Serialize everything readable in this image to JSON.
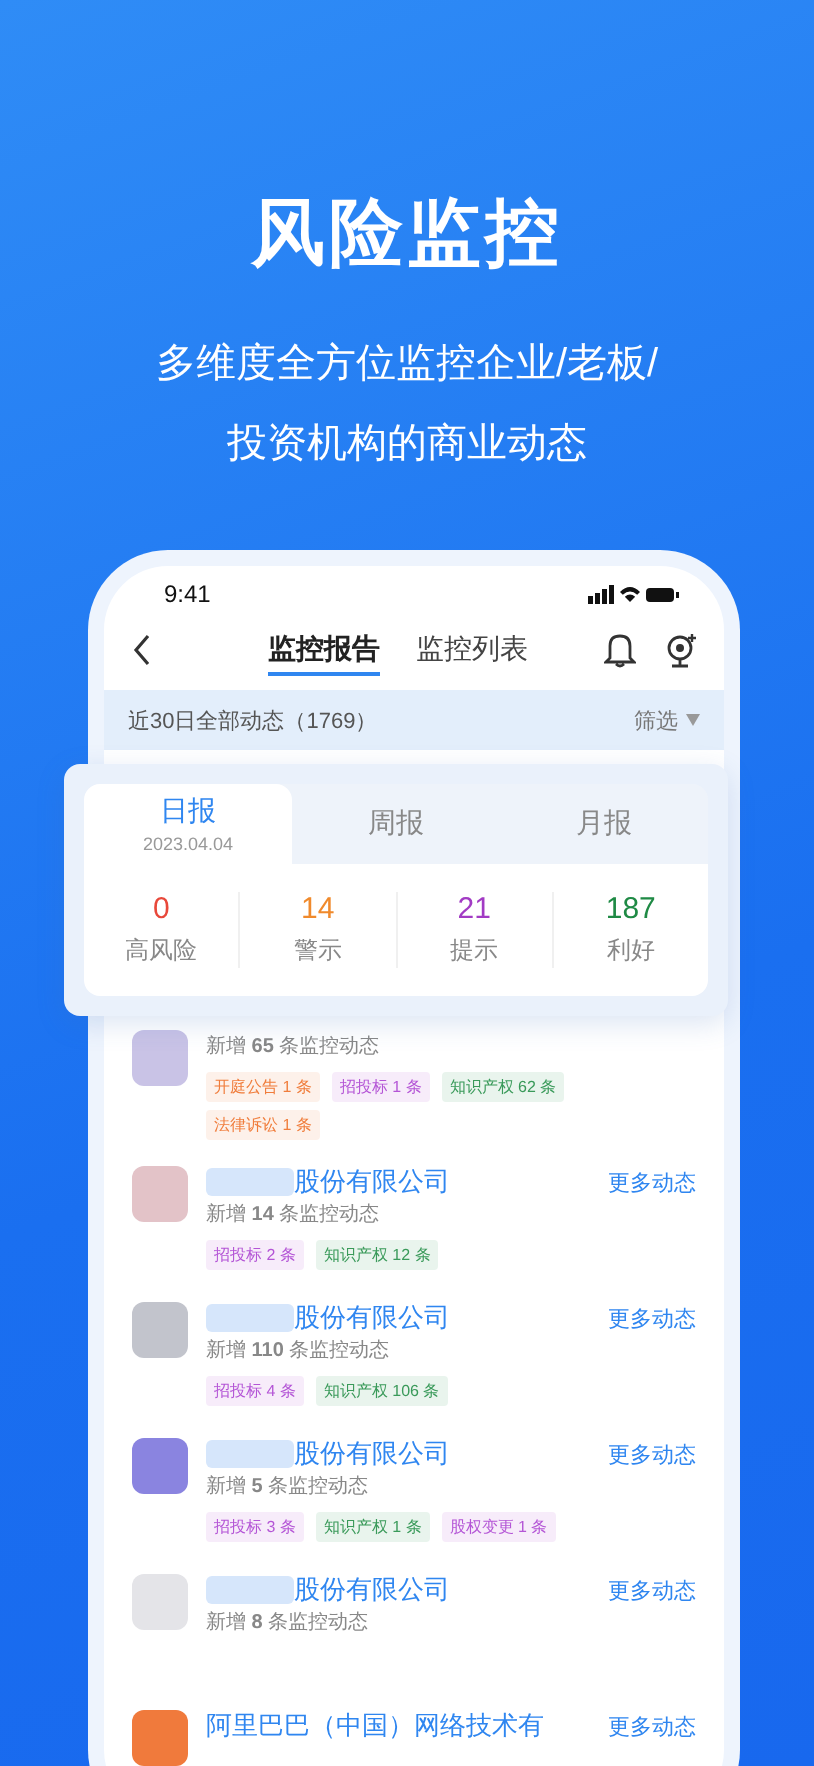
{
  "headline": "风险监控",
  "subtitle_lines": [
    "多维度全方位监控企业/老板/",
    "投资机构的商业动态"
  ],
  "status_bar": {
    "time": "9:41"
  },
  "nav_tabs": [
    {
      "label": "监控报告",
      "selected": true
    },
    {
      "label": "监控列表",
      "selected": false
    }
  ],
  "filter_bar": {
    "summary": "近30日全部动态（1769）",
    "filter": "筛选"
  },
  "report_tabs": [
    {
      "label": "日报",
      "date": "2023.04.04",
      "selected": true
    },
    {
      "label": "周报",
      "selected": false
    },
    {
      "label": "月报",
      "selected": false
    }
  ],
  "stats": [
    {
      "value": "0",
      "label": "高风险",
      "color": "#e8483a"
    },
    {
      "value": "14",
      "label": "警示",
      "color": "#f08a2c"
    },
    {
      "value": "21",
      "label": "提示",
      "color": "#a23bc4"
    },
    {
      "value": "187",
      "label": "利好",
      "color": "#1f8a45"
    }
  ],
  "companies": [
    {
      "color": "#c9c3e6",
      "count": "新增 **65** 条监控动态",
      "tags": [
        {
          "text": "开庭公告 1 条",
          "color": "#f07d3c"
        },
        {
          "text": "招投标 1 条",
          "color": "#b455d6"
        },
        {
          "text": "知识产权 62 条",
          "color": "#3a9a5a"
        },
        {
          "text": "法律诉讼 1 条",
          "color": "#f07d3c"
        }
      ]
    },
    {
      "color": "#e3c3c8",
      "name_blurred": true,
      "name": "股份有限公司",
      "more": "更多动态",
      "count": "新增 **14** 条监控动态",
      "tags": [
        {
          "text": "招投标 2 条",
          "color": "#b455d6"
        },
        {
          "text": "知识产权 12 条",
          "color": "#3a9a5a"
        }
      ]
    },
    {
      "color": "#c2c4cc",
      "name_blurred": true,
      "name": "股份有限公司",
      "more": "更多动态",
      "count": "新增 **110** 条监控动态",
      "tags": [
        {
          "text": "招投标 4 条",
          "color": "#b455d6"
        },
        {
          "text": "知识产权 106 条",
          "color": "#3a9a5a"
        }
      ]
    },
    {
      "color": "#8a84e0",
      "name_blurred": true,
      "name": "股份有限公司",
      "more": "更多动态",
      "count": "新增 **5** 条监控动态",
      "tags": [
        {
          "text": "招投标 3 条",
          "color": "#b455d6"
        },
        {
          "text": "知识产权 1 条",
          "color": "#3a9a5a"
        },
        {
          "text": "股权变更 1 条",
          "color": "#b455d6"
        }
      ]
    },
    {
      "color": "#e4e4e8",
      "name_blurred": true,
      "name": "股份有限公司",
      "more": "更多动态",
      "count": "新增 **8** 条监控动态"
    },
    {
      "color": "#f07a3c",
      "name_blurred": false,
      "name": "阿里巴巴（中国）网络技术有",
      "more": "更多动态"
    }
  ]
}
